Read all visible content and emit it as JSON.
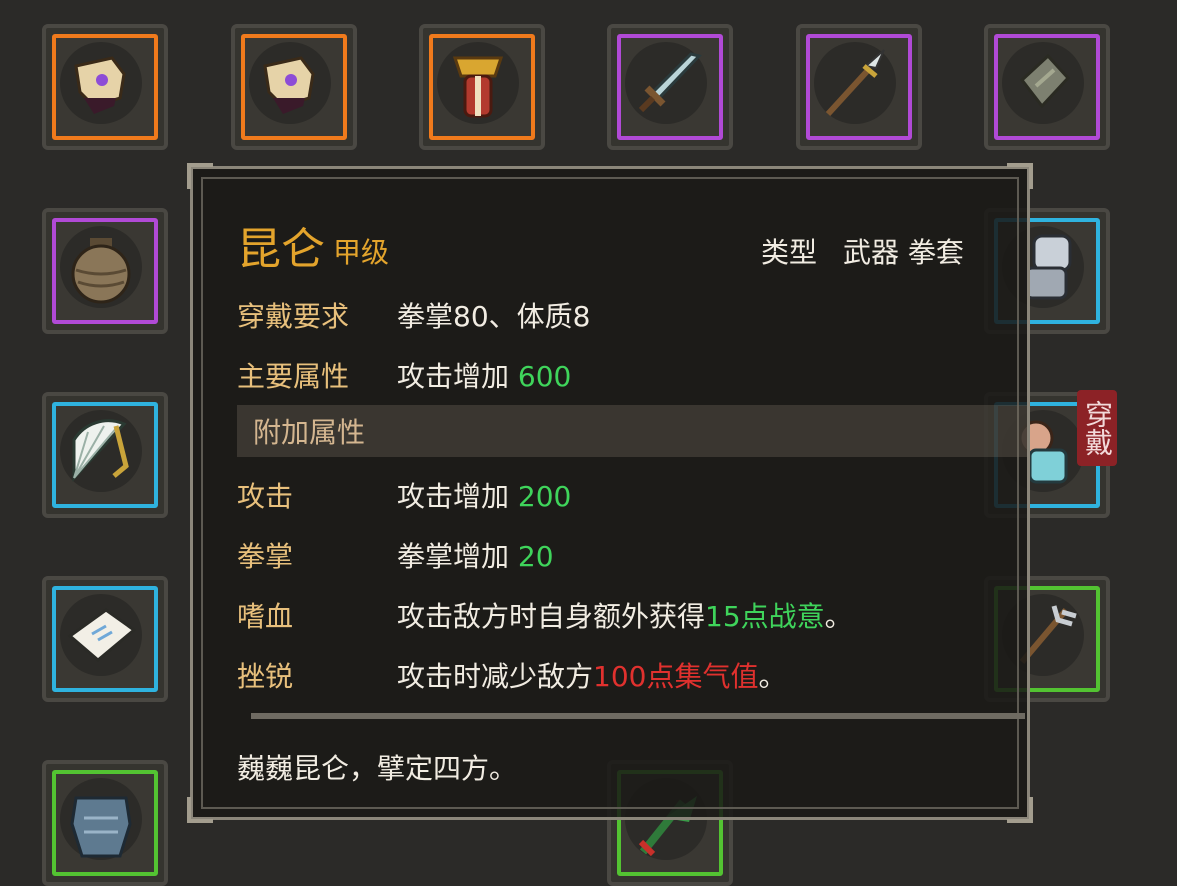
{
  "colors": {
    "rarity_orange": "#f07a1c",
    "rarity_purple": "#b14ad6",
    "rarity_blue": "#2fb3df",
    "rarity_green": "#53c332",
    "title_gold": "#e3a42c",
    "label_tan": "#e8c07c",
    "value_green": "#3fd45b",
    "value_red": "#e0312e"
  },
  "inventory": {
    "slots": [
      {
        "icon": "gauntlet-icon",
        "rarity": "orange"
      },
      {
        "icon": "gauntlet-icon",
        "rarity": "orange"
      },
      {
        "icon": "golden-armor-icon",
        "rarity": "orange"
      },
      {
        "icon": "sword-icon",
        "rarity": "purple"
      },
      {
        "icon": "spear-icon",
        "rarity": "purple"
      },
      {
        "icon": "stone-icon",
        "rarity": "purple"
      },
      {
        "icon": "jar-icon",
        "rarity": "purple"
      },
      {
        "icon": "steel-gauntlet-icon",
        "rarity": "blue"
      },
      {
        "icon": "fan-icon",
        "rarity": "blue"
      },
      {
        "icon": "robe-icon",
        "rarity": "blue"
      },
      {
        "icon": "scroll-icon",
        "rarity": "blue"
      },
      {
        "icon": "trident-icon",
        "rarity": "green"
      },
      {
        "icon": "armor-icon",
        "rarity": "green"
      },
      {
        "icon": "herb-icon",
        "rarity": "green"
      }
    ],
    "equipped_badge": "穿戴"
  },
  "tooltip": {
    "name": "昆仑",
    "grade": "甲级",
    "type_label": "类型",
    "type_value": "武器 拳套",
    "requirement": {
      "label": "穿戴要求",
      "value": "拳掌80、体质8"
    },
    "main_attr": {
      "label": "主要属性",
      "text": "攻击增加 ",
      "amount": "600"
    },
    "extra_section": "附加属性",
    "extras": [
      {
        "label": "攻击",
        "text": "攻击增加 ",
        "highlight": "200",
        "suffix": ""
      },
      {
        "label": "拳掌",
        "text": "拳掌增加 ",
        "highlight": "20",
        "suffix": ""
      },
      {
        "label": "嗜血",
        "text": "攻击敌方时自身额外获得",
        "highlight": "15点战意",
        "suffix": "。"
      },
      {
        "label": "挫锐",
        "text": "攻击时减少敌方",
        "highlight": "100点集气值",
        "suffix": "。"
      }
    ],
    "flavor": "巍巍昆仑，擘定四方。"
  }
}
